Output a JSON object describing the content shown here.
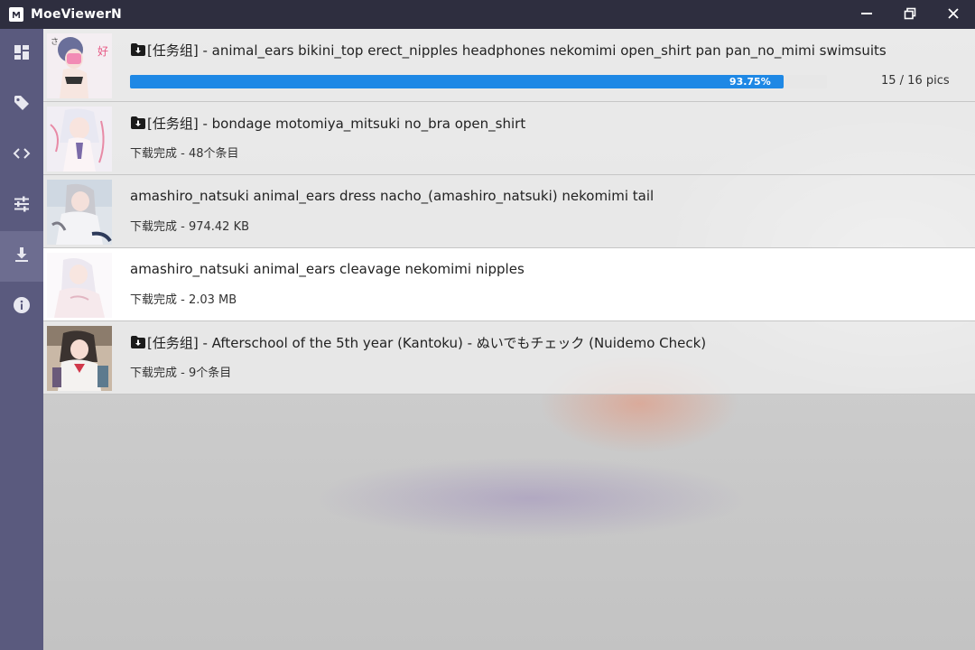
{
  "window": {
    "title": "MoeViewerN",
    "logo_icon": "m-logo-icon",
    "controls": [
      "minimize-icon",
      "restore-icon",
      "close-icon"
    ]
  },
  "sidebar": {
    "items": [
      {
        "icon": "dashboard-icon",
        "active": false
      },
      {
        "icon": "tag-icon",
        "active": false
      },
      {
        "icon": "code-icon",
        "active": false
      },
      {
        "icon": "sliders-icon",
        "active": false
      },
      {
        "icon": "download-icon",
        "active": true
      },
      {
        "icon": "info-icon",
        "active": false
      }
    ]
  },
  "downloads": [
    {
      "task_group": true,
      "title": "[任务组] - animal_ears bikini_top erect_nipples headphones nekomimi open_shirt pan pan_no_mimi swimsuits",
      "progress": 0.9375,
      "progress_label": "93.75%",
      "count_label": "15 / 16 pics"
    },
    {
      "task_group": true,
      "title": "[任务组] - bondage motomiya_mitsuki no_bra open_shirt",
      "status": "下载完成 - 48个条目"
    },
    {
      "task_group": false,
      "title": "amashiro_natsuki animal_ears dress nacho_(amashiro_natsuki) nekomimi tail",
      "status": "下载完成 - 974.42 KB"
    },
    {
      "task_group": false,
      "title": "amashiro_natsuki animal_ears cleavage nekomimi nipples",
      "status": "下载完成 - 2.03 MB"
    },
    {
      "task_group": true,
      "title": "[任务组] - Afterschool of the 5th year (Kantoku) - ぬいでもチェック (Nuidemo Check)",
      "status": "下载完成 - 9个条目"
    }
  ],
  "colors": {
    "titlebar": "#2e2e3f",
    "sidebar": "#5a5a7e",
    "sidebar_active": "#6d6d90",
    "progress": "#1e88e5"
  }
}
